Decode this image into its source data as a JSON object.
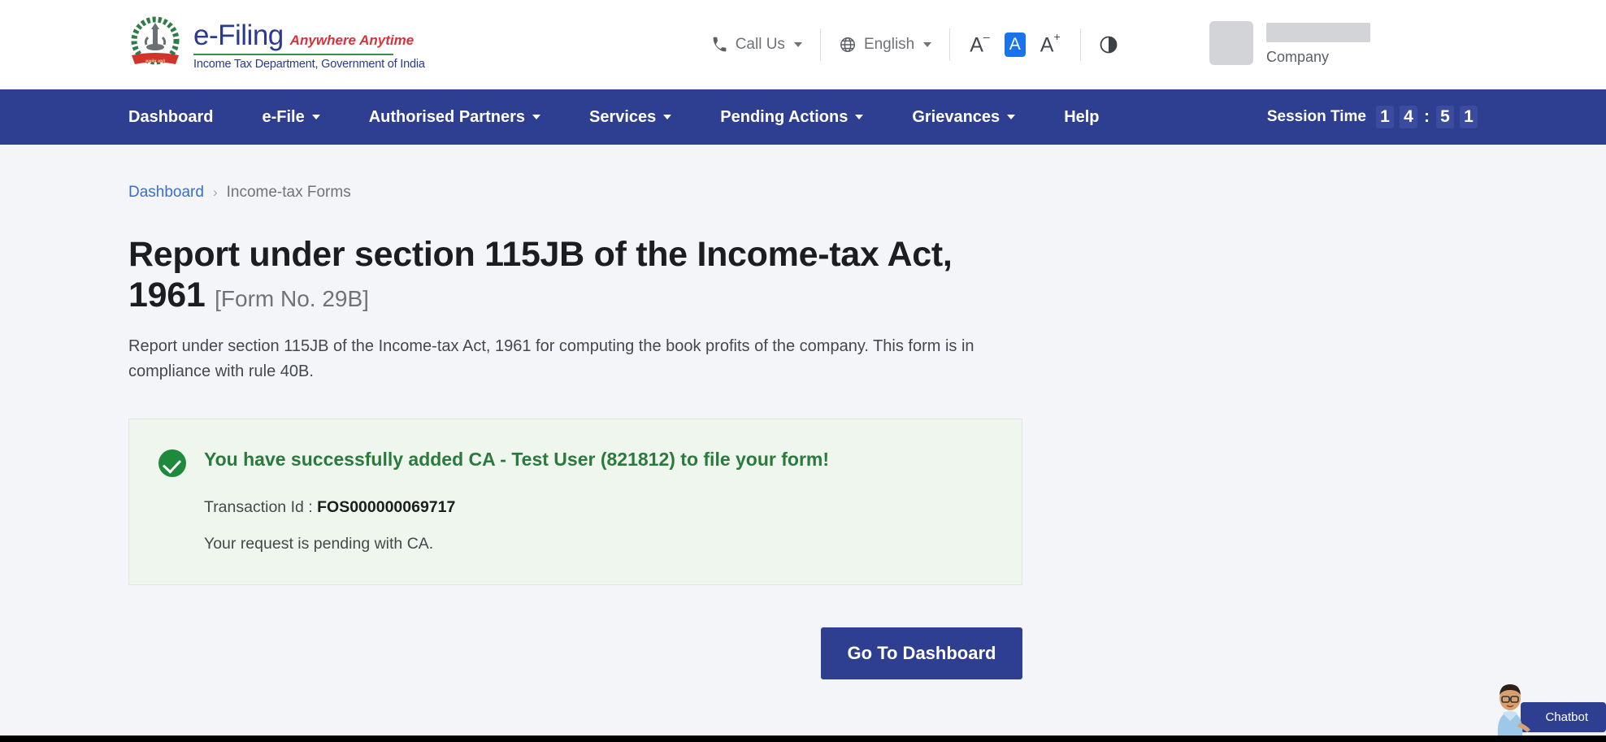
{
  "brand": {
    "emblem_icon": "india-national-emblem-icon",
    "title": "e-Filing",
    "tagline": "Anywhere Anytime",
    "subtitle": "Income Tax Department, Government of India"
  },
  "utility_bar": {
    "call_us": {
      "label": "Call Us",
      "icon": "phone-icon",
      "chevron": "chevron-down-icon"
    },
    "language": {
      "label": "English",
      "icon": "globe-icon",
      "chevron": "chevron-down-icon"
    },
    "font_decrease": {
      "label": "A",
      "sup": "–",
      "icon": "font-decrease-icon"
    },
    "font_default": {
      "label": "A",
      "icon": "font-default-icon"
    },
    "font_increase": {
      "label": "A",
      "sup": "+",
      "icon": "font-increase-icon"
    },
    "contrast": {
      "icon": "contrast-toggle-icon"
    },
    "user": {
      "name_redacted": "",
      "role": "Company",
      "avatar_icon": "avatar-placeholder-icon"
    }
  },
  "nav": {
    "items": [
      {
        "label": "Dashboard",
        "has_chevron": false
      },
      {
        "label": "e-File",
        "has_chevron": true
      },
      {
        "label": "Authorised Partners",
        "has_chevron": true
      },
      {
        "label": "Services",
        "has_chevron": true
      },
      {
        "label": "Pending Actions",
        "has_chevron": true
      },
      {
        "label": "Grievances",
        "has_chevron": true
      },
      {
        "label": "Help",
        "has_chevron": false
      }
    ],
    "session": {
      "label": "Session Time",
      "digits": [
        "1",
        "4",
        "5",
        "1"
      ],
      "separator": ":"
    }
  },
  "breadcrumb": {
    "root": "Dashboard",
    "separator": "›",
    "current": "Income-tax Forms"
  },
  "page": {
    "title": "Report under section 115JB of the Income-tax Act, 1961",
    "form_no": "[Form No. 29B]",
    "description": "Report under section 115JB of the Income-tax Act, 1961 for computing the book profits of the company. This form is in compliance with rule 40B."
  },
  "alert": {
    "icon": "success-check-icon",
    "title": "You have successfully added CA - Test User (821812) to file your form!",
    "transaction_label": "Transaction Id :",
    "transaction_id": "FOS000000069717",
    "status_text": "Your request is pending with CA."
  },
  "actions": {
    "primary_button": "Go To Dashboard"
  },
  "chatbot": {
    "label": "Chatbot",
    "avatar_icon": "chatbot-avatar-icon"
  },
  "colors": {
    "brand_blue": "#2e3f91",
    "accent_red": "#d4343a",
    "accent_green": "#3b8f4a",
    "success_green": "#2b7a3d",
    "success_bg": "#eef6ed",
    "link_blue": "#3b6ec9",
    "page_bg": "#f4f5f9",
    "font_active_blue": "#1a73e8"
  }
}
